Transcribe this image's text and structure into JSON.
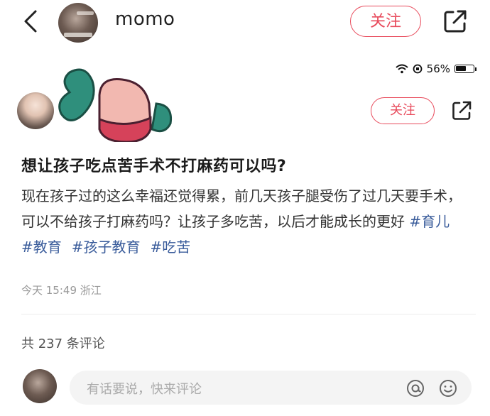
{
  "header": {
    "username": "momo",
    "follow_label": "关注"
  },
  "status_bar": {
    "battery": "56%"
  },
  "post": {
    "follow_label": "关注",
    "title": "想让孩子吃点苦手术不打麻药可以吗?",
    "body": "现在孩子过的这么幸福还觉得累，前几天孩子腿受伤了过几天要手术，可以不给孩子打麻药吗？让孩子多吃苦，以后才能成长的更好 ",
    "tags": [
      "#育儿",
      "#教育",
      "#孩子教育",
      "#吃苦"
    ],
    "meta": "今天 15:49 浙江"
  },
  "comments": {
    "count_label": "共 237 条评论",
    "input_placeholder": "有话要说，快来评论"
  },
  "colors": {
    "accent": "#e84b5c",
    "tag": "#3a5c9b"
  },
  "icons": [
    "back-icon",
    "share-icon",
    "wifi-icon",
    "battery-icon",
    "at-icon",
    "emoji-icon"
  ]
}
